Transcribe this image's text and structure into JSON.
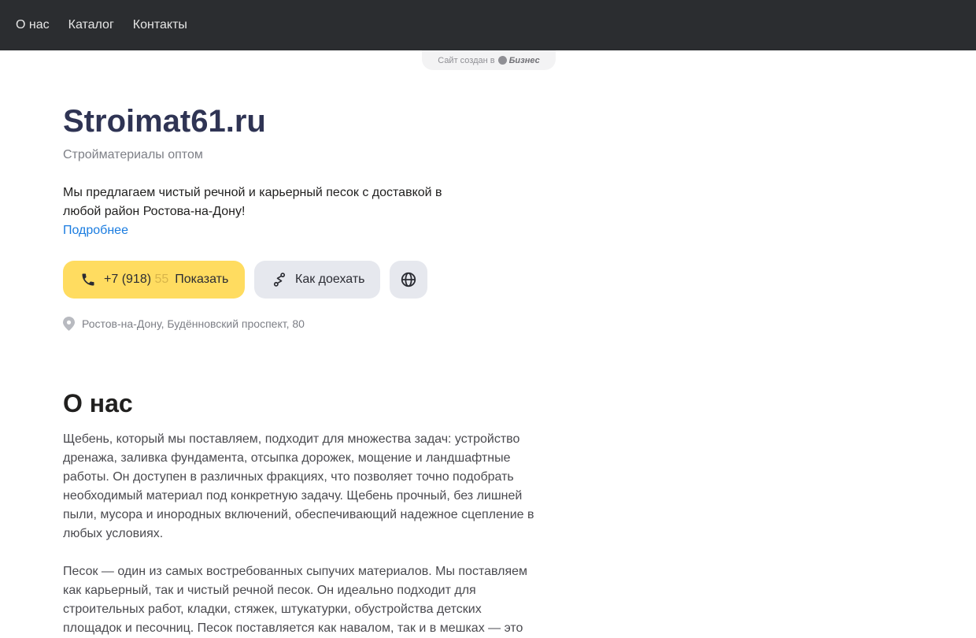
{
  "nav": {
    "items": [
      {
        "label": "О нас"
      },
      {
        "label": "Каталог"
      },
      {
        "label": "Контакты"
      }
    ]
  },
  "badge": {
    "text": "Сайт создан в",
    "brand": "Бизнес"
  },
  "hero": {
    "title": "Stroimat61.ru",
    "subtitle": "Стройматериалы оптом",
    "description": "Мы предлагаем чистый речной и карьерный песок с доставкой в любой район Ростова-на-Дону!",
    "more_link": "Подробнее"
  },
  "actions": {
    "phone_visible": "+7 (918) ",
    "phone_faded": "55",
    "phone_show_label": "Показать",
    "route_label": "Как доехать",
    "web_icon": "globe-icon"
  },
  "address": {
    "text": "Ростов-на-Дону, Будённовский проспект, 80"
  },
  "about": {
    "heading": "О нас",
    "paragraphs": [
      "Щебень, который мы поставляем, подходит для множества задач: устройство дренажа, заливка фундамента, отсыпка дорожек, мощение и ландшафтные работы. Он доступен в различных фракциях, что позволяет точно подобрать необходимый материал под конкретную задачу. Щебень прочный, без лишней пыли, мусора и инородных включений, обеспечивающий надежное сцепление в любых условиях.",
      "Песок — один из самых востребованных сыпучих материалов. Мы поставляем как карьерный, так и чистый речной песок. Он идеально подходит для строительных работ, кладки, стяжек, штукатурки, обустройства детских площадок и песочниц. Песок поставляется как навалом, так и в мешках — это"
    ]
  },
  "colors": {
    "topbar": "#2b2d30",
    "title": "#2f3454",
    "accent_yellow": "#ffdc60",
    "secondary_button": "#e6e8ee",
    "link": "#1a7ce0"
  }
}
